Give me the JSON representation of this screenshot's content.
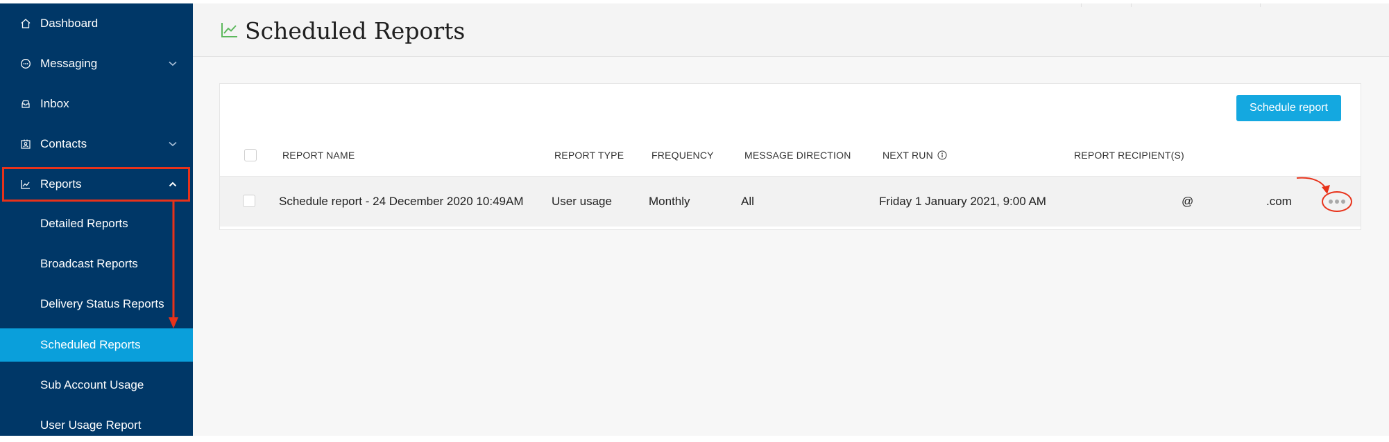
{
  "sidebar": {
    "items": [
      {
        "label": "Dashboard",
        "icon": "home-icon"
      },
      {
        "label": "Messaging",
        "icon": "chat-icon",
        "expandable": true
      },
      {
        "label": "Inbox",
        "icon": "inbox-icon"
      },
      {
        "label": "Contacts",
        "icon": "contacts-icon",
        "expandable": true
      },
      {
        "label": "Reports",
        "icon": "chart-icon",
        "expanded": true
      }
    ],
    "subitems": [
      {
        "label": "Detailed Reports"
      },
      {
        "label": "Broadcast Reports"
      },
      {
        "label": "Delivery Status Reports"
      },
      {
        "label": "Scheduled Reports",
        "active": true
      },
      {
        "label": "Sub Account Usage"
      },
      {
        "label": "User Usage Report"
      }
    ]
  },
  "page": {
    "title": "Scheduled Reports",
    "title_icon": "line-chart-icon"
  },
  "toolbar": {
    "schedule_button": "Schedule report"
  },
  "table": {
    "columns": [
      "REPORT NAME",
      "REPORT TYPE",
      "FREQUENCY",
      "MESSAGE DIRECTION",
      "NEXT RUN",
      "REPORT RECIPIENT(S)"
    ],
    "rows": [
      {
        "name": "Schedule report - 24 December 2020 10:49AM",
        "type": "User usage",
        "frequency": "Monthly",
        "direction": "All",
        "next_run": "Friday 1 January 2021, 9:00 AM",
        "recipient_at": "@",
        "recipient_domain": ".com"
      }
    ]
  },
  "colors": {
    "sidebar_bg": "#003767",
    "active_item": "#0a9fdb",
    "button": "#14a8e0",
    "annotation": "#e8321a",
    "title_icon": "#5cb85c"
  }
}
